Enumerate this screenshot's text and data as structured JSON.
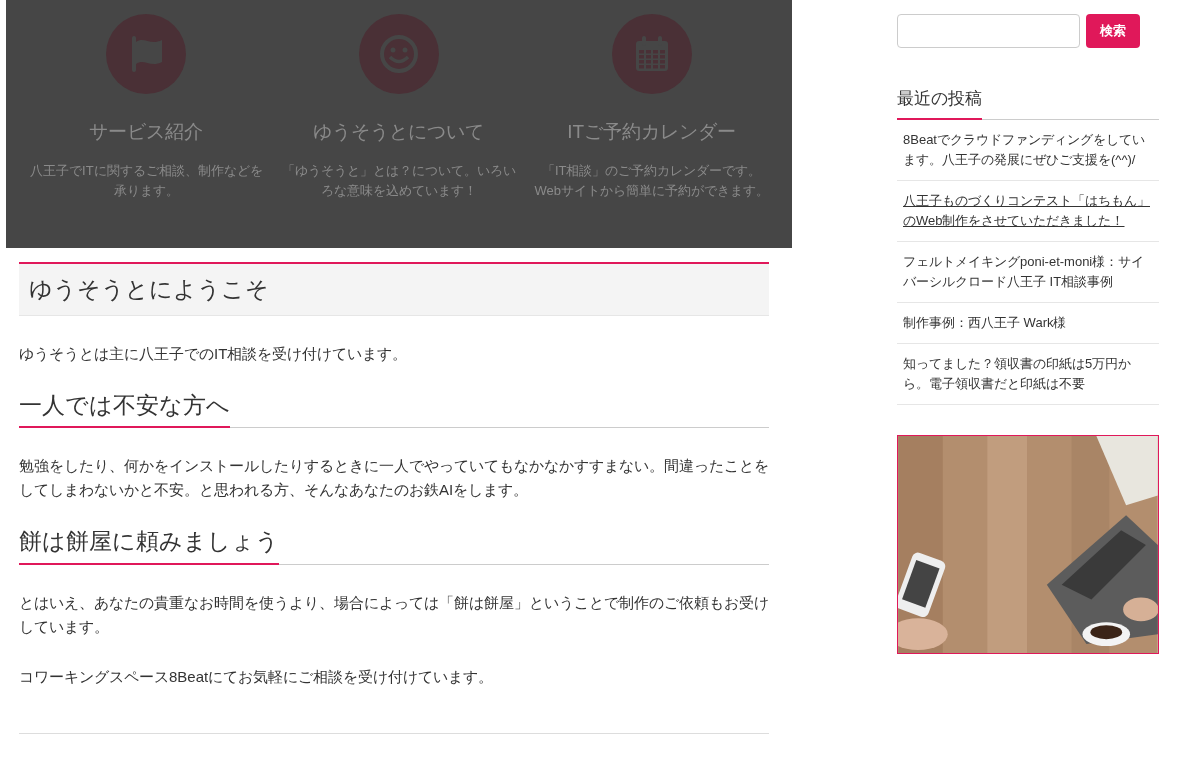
{
  "features": [
    {
      "title": "サービス紹介",
      "text": "八王子でITに関するご相談、制作などを承ります。"
    },
    {
      "title": "ゆうそうとについて",
      "text": "「ゆうそうと」とは？について。いろいろな意味を込めています！"
    },
    {
      "title": "ITご予約カレンダー",
      "text": "「IT相談」のご予約カレンダーです。Webサイトから簡単に予約ができます。"
    }
  ],
  "article": {
    "title": "ゆうそうとにようこそ",
    "blocks": [
      {
        "kind": "paragraph",
        "text": "ゆうそうとは主に八王子でのIT相談を受け付けています。"
      },
      {
        "kind": "heading",
        "text": "一人では不安な方へ"
      },
      {
        "kind": "paragraph",
        "text": "勉強をしたり、何かをインストールしたりするときに一人でやっていてもなかなかすすまない。間違ったことをしてしまわないかと不安。と思われる方、そんなあなたのお鉄AIをします。"
      },
      {
        "kind": "heading",
        "text": "餅は餅屋に頼みましょう"
      },
      {
        "kind": "paragraph",
        "text": "とはいえ、あなたの貴重なお時間を使うより、場合によっては「餅は餅屋」ということで制作のご依頼もお受けしています。"
      },
      {
        "kind": "paragraph",
        "text": "コワーキングスペース8Beatにてお気軽にご相談を受け付けています。"
      }
    ]
  },
  "sidebar": {
    "search_button": "検索",
    "recent_title": "最近の投稿",
    "posts": [
      {
        "title": "8Beatでクラウドファンディングをしています。八王子の発展にぜひご支援を(^^)/",
        "hovered": false
      },
      {
        "title": "八王子ものづくりコンテスト「はちもん」のWeb制作をさせていただきました！",
        "hovered": true
      },
      {
        "title": "フェルトメイキングponi-et-moni様：サイバーシルクロード八王子 IT相談事例",
        "hovered": false
      },
      {
        "title": "制作事例：西八王子 Wark様",
        "hovered": false
      },
      {
        "title": "知ってました？領収書の印紙は5万円から。電子領収書だと印紙は不要",
        "hovered": false
      }
    ]
  }
}
